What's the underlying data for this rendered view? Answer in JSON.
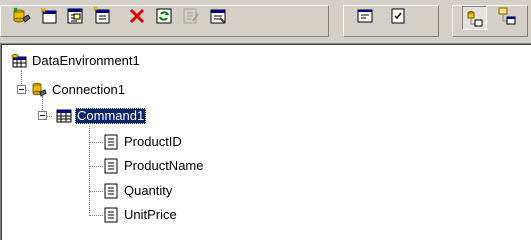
{
  "toolbar": {
    "buttons": [
      {
        "name": "add-connection-button",
        "icon": "add-connection-icon",
        "enabled": true
      },
      {
        "name": "add-command-button",
        "icon": "add-command-icon",
        "enabled": true
      },
      {
        "name": "add-child-command-button",
        "icon": "add-child-command-icon",
        "enabled": true
      },
      {
        "name": "insert-stored-procedures-button",
        "icon": "insert-procedures-icon",
        "enabled": true
      },
      {
        "name": "delete-button",
        "icon": "delete-icon",
        "enabled": true
      },
      {
        "name": "refresh-button",
        "icon": "refresh-icon",
        "enabled": true
      },
      {
        "name": "design-button",
        "icon": "design-icon",
        "enabled": false
      },
      {
        "name": "properties-button",
        "icon": "properties-icon",
        "enabled": true
      },
      {
        "name": "view-code-button",
        "icon": "view-code-icon",
        "enabled": true
      },
      {
        "name": "options-button",
        "icon": "options-icon",
        "enabled": true
      },
      {
        "name": "arrange-by-connections-button",
        "icon": "arrange-by-connections-icon",
        "enabled": true,
        "pressed": true
      },
      {
        "name": "arrange-by-objects-button",
        "icon": "arrange-by-objects-icon",
        "enabled": true
      }
    ]
  },
  "tree": {
    "root": {
      "label": "DataEnvironment1",
      "icon": "data-environment-icon"
    },
    "connection": {
      "label": "Connection1",
      "icon": "connection-icon",
      "expanded": true
    },
    "command": {
      "label": "Command1",
      "icon": "command-icon",
      "expanded": true,
      "selected": true
    },
    "fields": [
      {
        "label": "ProductID",
        "icon": "field-icon"
      },
      {
        "label": "ProductName",
        "icon": "field-icon"
      },
      {
        "label": "Quantity",
        "icon": "field-icon"
      },
      {
        "label": "UnitPrice",
        "icon": "field-icon"
      }
    ]
  },
  "colors": {
    "chrome": "#d4d0c8",
    "selection": "#0a246a",
    "delete_red": "#e00000"
  }
}
